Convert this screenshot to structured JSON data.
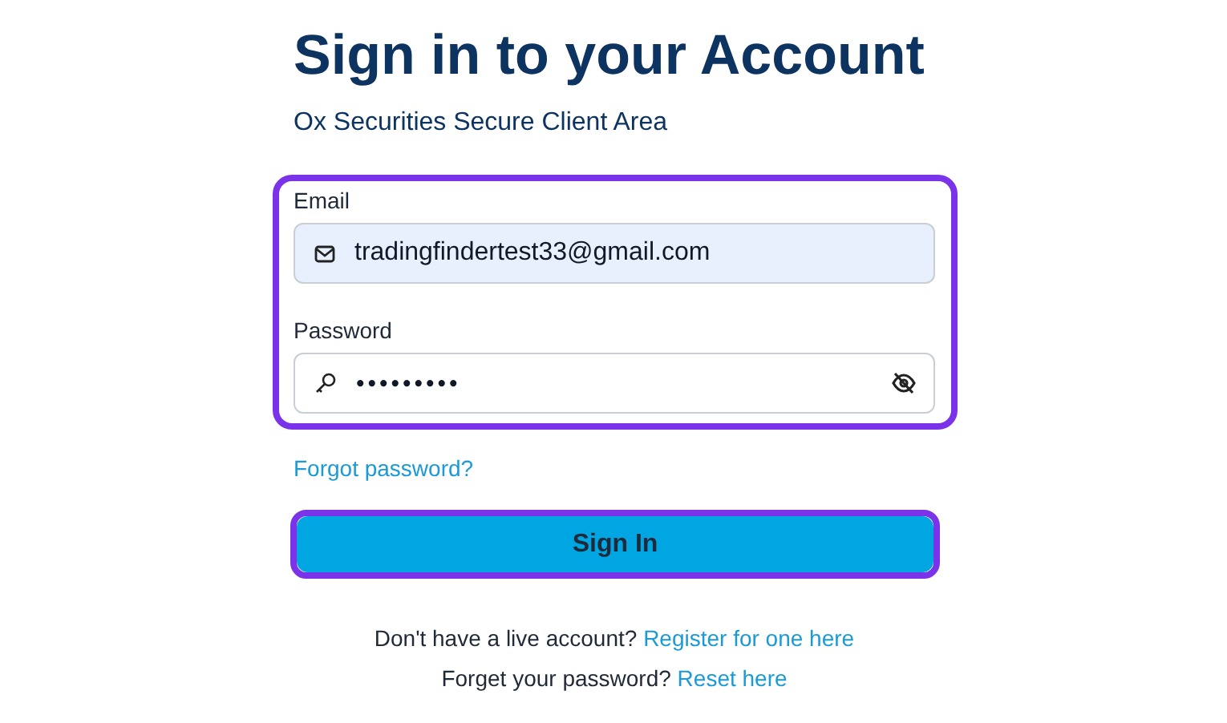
{
  "title": "Sign in to your Account",
  "subtitle": "Ox Securities Secure Client Area",
  "credentials": {
    "highlighted": true,
    "email": {
      "label": "Email",
      "value": "tradingfindertest33@gmail.com"
    },
    "password": {
      "label": "Password",
      "value": "•••••••••"
    }
  },
  "forgot_link": "Forgot password?",
  "sign_in_button": {
    "label": "Sign In",
    "highlighted": true
  },
  "register_prompt": {
    "text": "Don't have a live account?",
    "link": "Register for one here"
  },
  "reset_prompt": {
    "text": "Forget your password?",
    "link": "Reset here"
  }
}
